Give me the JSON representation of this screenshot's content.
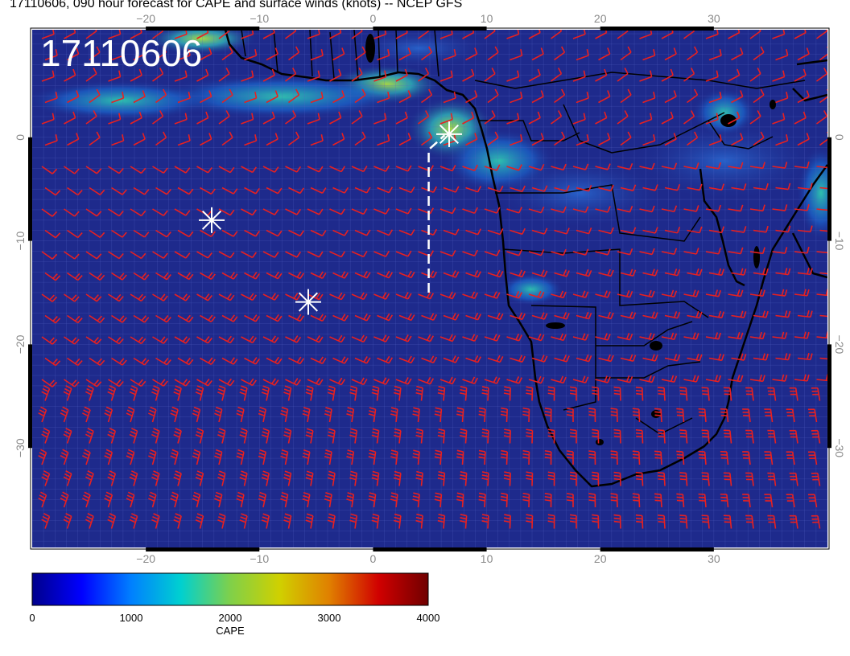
{
  "title": "17110606, 090 hour forecast for CAPE and surface winds (knots) -- NCEP GFS",
  "stamp": "17110606",
  "map": {
    "lon_range": [
      -30,
      40
    ],
    "lat_range": [
      -40,
      10
    ],
    "lon_ticks": [
      "-20",
      "-10",
      "0",
      "10",
      "20",
      "30"
    ],
    "lat_ticks": [
      "0",
      "-10",
      "-20",
      "-30"
    ],
    "ocean_color": "#1e2a8c",
    "wind_color": "#e82020",
    "coast_color": "#000000",
    "markers": [
      {
        "name": "star-marker-1",
        "lon": -14.2,
        "lat": -8.0
      },
      {
        "name": "star-marker-2",
        "lon": -5.7,
        "lat": -15.9
      },
      {
        "name": "star-marker-3",
        "lon": 6.7,
        "lat": 0.3
      }
    ],
    "track": [
      [
        4.9,
        -15.0
      ],
      [
        4.9,
        -1.2
      ],
      [
        6.3,
        0.2
      ]
    ]
  },
  "colorbar": {
    "label": "CAPE",
    "min": 0,
    "max": 4000,
    "ticks": [
      "0",
      "1000",
      "2000",
      "3000",
      "4000"
    ],
    "colors": [
      "#00008b",
      "#0000ff",
      "#0080ff",
      "#00d0d0",
      "#7fd04a",
      "#d0d000",
      "#e08000",
      "#d00000",
      "#700000"
    ]
  }
}
